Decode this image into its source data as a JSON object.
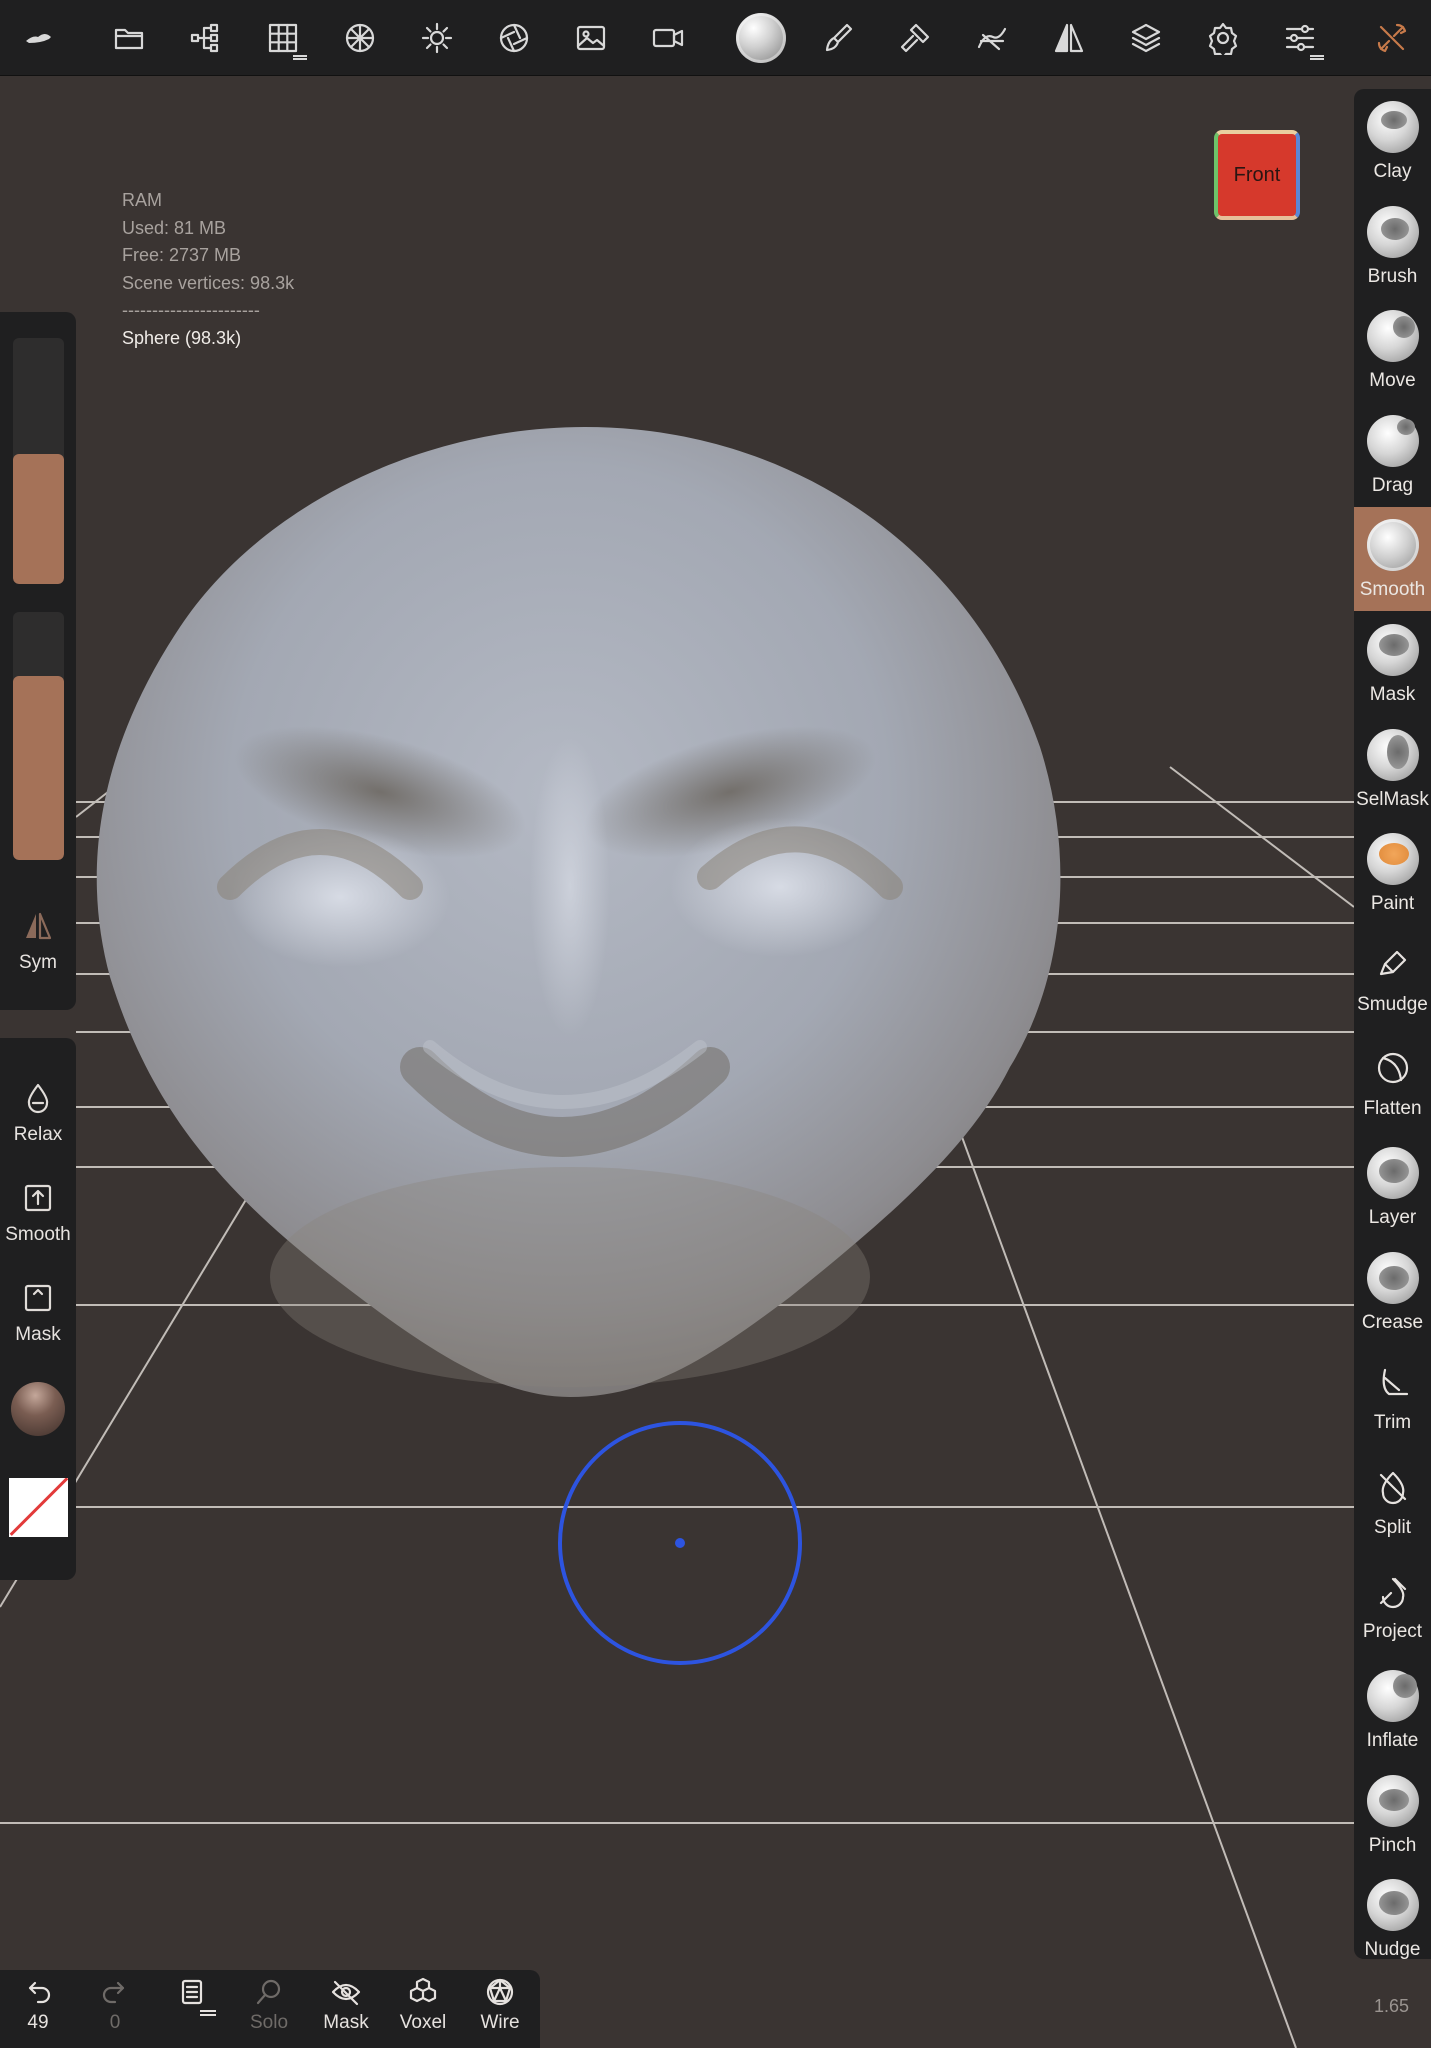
{
  "ram_info": {
    "title": "RAM",
    "used": "Used: 81 MB",
    "free": "Free: 2737 MB",
    "vertices": "Scene vertices: 98.3k",
    "separator": "-----------------------",
    "object": "Sphere (98.3k)"
  },
  "view_cube": {
    "label": "Front"
  },
  "toolbar": {
    "icons": [
      "app-logo-icon",
      "folder-icon",
      "scene-tree-icon",
      "grid-icon",
      "topology-icon",
      "light-icon",
      "shading-icon",
      "image-icon",
      "camera-icon",
      "active-tool-icon",
      "paint-brush-icon",
      "hammer-icon",
      "stroke-icon",
      "symmetry-icon",
      "layers-icon",
      "settings-icon",
      "sliders-icon",
      "tools-icon"
    ]
  },
  "left_panel": {
    "radius_level": 0.53,
    "intensity_level": 0.74,
    "sym_label": "Sym",
    "relax_label": "Relax",
    "smooth_label": "Smooth",
    "mask_label": "Mask"
  },
  "tools": [
    {
      "label": "Clay"
    },
    {
      "label": "Brush"
    },
    {
      "label": "Move"
    },
    {
      "label": "Drag"
    },
    {
      "label": "Smooth",
      "active": true
    },
    {
      "label": "Mask"
    },
    {
      "label": "SelMask"
    },
    {
      "label": "Paint"
    },
    {
      "label": "Smudge"
    },
    {
      "label": "Flatten"
    },
    {
      "label": "Layer"
    },
    {
      "label": "Crease"
    },
    {
      "label": "Trim"
    },
    {
      "label": "Split"
    },
    {
      "label": "Project"
    },
    {
      "label": "Inflate"
    },
    {
      "label": "Pinch"
    },
    {
      "label": "Nudge"
    }
  ],
  "bottom_bar": {
    "undo_count": "49",
    "redo_count": "0",
    "solo_label": "Solo",
    "mask_label": "Mask",
    "voxel_label": "Voxel",
    "wire_label": "Wire"
  },
  "zoom_level": "1.65",
  "colors": {
    "accent": "#a57258",
    "background": "#3a3432",
    "panel": "#1f1f20",
    "cursor": "#2d54e0"
  }
}
